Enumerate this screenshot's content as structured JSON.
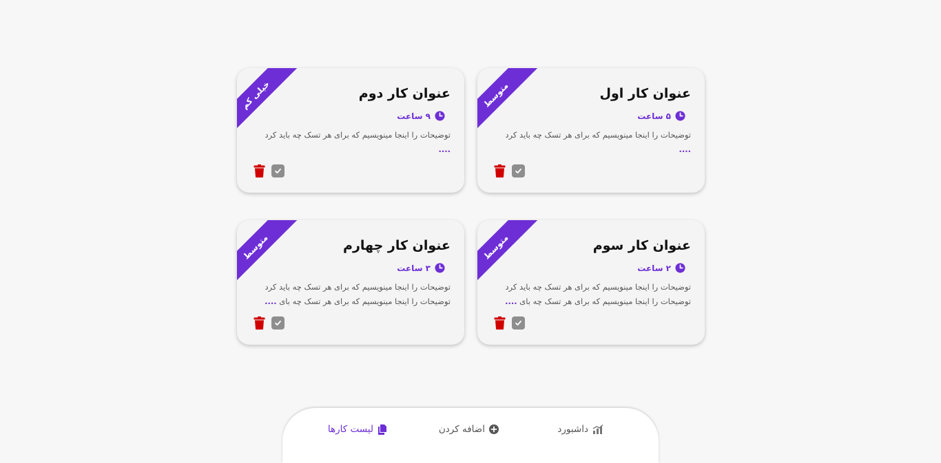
{
  "tasks": [
    {
      "title": "عنوان کار اول",
      "time": "۵ ساعت",
      "priority": "متوسط",
      "description": "توضیحات را اینجا مینویسیم که برای هر تسک چه باید کرد",
      "more": "...."
    },
    {
      "title": "عنوان کار دوم",
      "time": "۹ ساعت",
      "priority": "خیلی کم",
      "description": "توضیحات را اینجا مینویسیم که برای هر تسک چه باید کرد",
      "more": "...."
    },
    {
      "title": "عنوان کار سوم",
      "time": "۲ ساعت",
      "priority": "متوسط",
      "description": "توضیحات را اینجا مینویسیم که برای هر تسک چه باید کرد توضیحات را اینجا مینویسیم که برای هر تسک چه بای",
      "more": "...."
    },
    {
      "title": "عنوان کار چهارم",
      "time": "۳ ساعت",
      "priority": "متوسط",
      "description": "توضیحات را اینجا مینویسیم که برای هر تسک چه باید کرد توضیحات را اینجا مینویسیم که برای هر تسک چه بای",
      "more": "...."
    }
  ],
  "nav": {
    "task_list": "لیست کارها",
    "add": "اضافه کردن",
    "dashboard": "داشبورد"
  },
  "icons": {
    "clock": "clock-icon",
    "trash": "trash-icon",
    "check": "check-icon",
    "task_list": "document-icon",
    "add": "plus-circle-icon",
    "dashboard": "chart-icon"
  },
  "colors": {
    "accent": "#6d2ed6",
    "delete": "#d10000",
    "check": "#8e8e8e",
    "card_bg": "#f4f4f4",
    "page_bg": "#f7f7f7"
  }
}
